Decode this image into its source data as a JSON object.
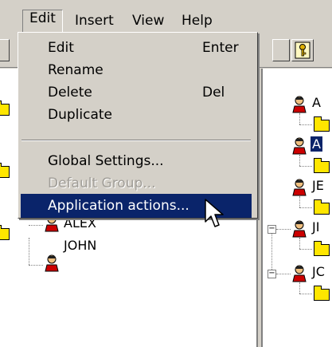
{
  "menubar": {
    "items": [
      {
        "label": "Edit"
      },
      {
        "label": "Insert"
      },
      {
        "label": "View"
      },
      {
        "label": "Help"
      }
    ]
  },
  "edit_menu": {
    "items": [
      {
        "label": "Edit",
        "shortcut": "Enter",
        "enabled": true
      },
      {
        "label": "Rename",
        "shortcut": "",
        "enabled": true
      },
      {
        "label": "Delete",
        "shortcut": "Del",
        "enabled": true
      },
      {
        "label": "Duplicate",
        "shortcut": "",
        "enabled": true
      },
      {
        "label": "Global Settings...",
        "shortcut": "",
        "enabled": true
      },
      {
        "label": "Default Group...",
        "shortcut": "",
        "enabled": false
      },
      {
        "label": "Application actions...",
        "shortcut": "",
        "enabled": true,
        "highlighted": true
      }
    ]
  },
  "left_tree": {
    "users": [
      {
        "label": "ALEX"
      },
      {
        "label": "JOHN"
      }
    ]
  },
  "right_tree": {
    "nodes": [
      {
        "label": "A"
      },
      {
        "label": "A"
      },
      {
        "label": "JE"
      },
      {
        "label": "JI"
      },
      {
        "label": "JC"
      }
    ]
  },
  "colors": {
    "face": "#d4d0c8",
    "highlight": "#0a246a",
    "folder": "#ffe600"
  }
}
